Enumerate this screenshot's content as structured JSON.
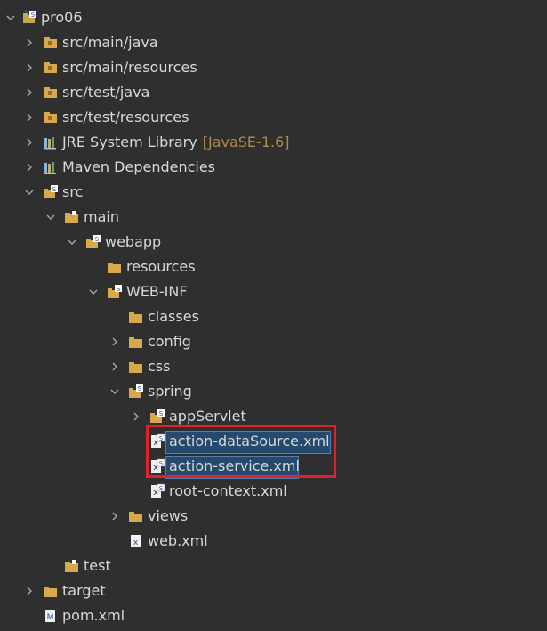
{
  "tree": {
    "project": "pro06",
    "items": [
      {
        "label": "src/main/java",
        "icon": "package-folder-icon"
      },
      {
        "label": "src/main/resources",
        "icon": "package-folder-icon"
      },
      {
        "label": "src/test/java",
        "icon": "package-folder-icon"
      },
      {
        "label": "src/test/resources",
        "icon": "package-folder-icon"
      },
      {
        "label": "JRE System Library",
        "suffix": "[JavaSE-1.6]",
        "icon": "library-icon"
      },
      {
        "label": "Maven Dependencies",
        "icon": "library-icon"
      },
      {
        "label": "src",
        "icon": "spring-folder-icon"
      },
      {
        "label": "main",
        "icon": "folder-icon"
      },
      {
        "label": "webapp",
        "icon": "spring-folder-icon"
      },
      {
        "label": "resources",
        "icon": "folder-icon"
      },
      {
        "label": "WEB-INF",
        "icon": "spring-folder-icon"
      },
      {
        "label": "classes",
        "icon": "folder-icon"
      },
      {
        "label": "config",
        "icon": "folder-icon"
      },
      {
        "label": "css",
        "icon": "folder-icon"
      },
      {
        "label": "spring",
        "icon": "spring-folder-icon"
      },
      {
        "label": "appServlet",
        "icon": "spring-folder-icon"
      },
      {
        "label": "action-dataSource.xml",
        "icon": "spring-xml-icon"
      },
      {
        "label": "action-service.xml",
        "icon": "spring-xml-icon"
      },
      {
        "label": "root-context.xml",
        "icon": "spring-xml-icon"
      },
      {
        "label": "views",
        "icon": "folder-icon"
      },
      {
        "label": "web.xml",
        "icon": "xml-file-icon"
      },
      {
        "label": "test",
        "icon": "folder-icon"
      },
      {
        "label": "target",
        "icon": "folder-icon"
      },
      {
        "label": "pom.xml",
        "icon": "maven-pom-icon"
      }
    ]
  },
  "colors": {
    "background": "#2f2f2f",
    "text": "#d8d8d8",
    "suffix": "#b08a4c",
    "selection": "#264a6e",
    "highlight_box": "#e0202a"
  }
}
